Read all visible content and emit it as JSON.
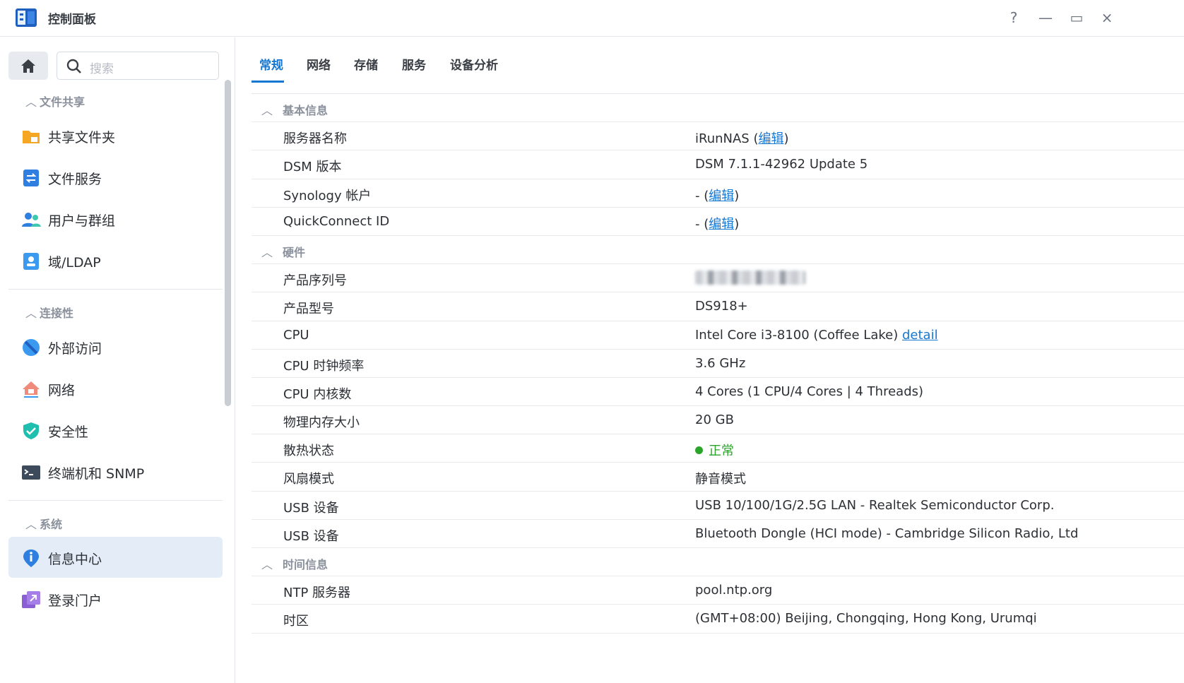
{
  "app": {
    "title": "控制面板",
    "icon": "control-panel-icon"
  },
  "window_controls": {
    "help": "?",
    "minimize": "—",
    "maximize": "▭",
    "close": "×"
  },
  "sidebar": {
    "search_placeholder": "搜索",
    "groups": [
      {
        "title": "文件共享",
        "items": [
          {
            "label": "共享文件夹",
            "icon": "shared-folder-icon"
          },
          {
            "label": "文件服务",
            "icon": "file-services-icon"
          },
          {
            "label": "用户与群组",
            "icon": "user-group-icon"
          },
          {
            "label": "域/LDAP",
            "icon": "domain-ldap-icon"
          }
        ]
      },
      {
        "title": "连接性",
        "items": [
          {
            "label": "外部访问",
            "icon": "external-access-icon"
          },
          {
            "label": "网络",
            "icon": "network-icon"
          },
          {
            "label": "安全性",
            "icon": "security-shield-icon"
          },
          {
            "label": "终端机和 SNMP",
            "icon": "terminal-icon"
          }
        ]
      },
      {
        "title": "系统",
        "items": [
          {
            "label": "信息中心",
            "icon": "info-center-icon",
            "active": true
          },
          {
            "label": "登录门户",
            "icon": "login-portal-icon"
          }
        ]
      }
    ]
  },
  "tabs": [
    "常规",
    "网络",
    "存储",
    "服务",
    "设备分析"
  ],
  "active_tab": "常规",
  "sections": {
    "basic": {
      "title": "基本信息",
      "server_name_label": "服务器名称",
      "server_name_value": "iRunNAS",
      "edit": "编辑",
      "dsm_label": "DSM 版本",
      "dsm_value": "DSM 7.1.1-42962 Update 5",
      "synology_label": "Synology 帐户",
      "synology_value": "-",
      "qc_label": "QuickConnect ID",
      "qc_value": "-"
    },
    "hardware": {
      "title": "硬件",
      "serial_label": "产品序列号",
      "model_label": "产品型号",
      "model_value": "DS918+",
      "cpu_label": "CPU",
      "cpu_value": "Intel Core i3-8100 (Coffee Lake)",
      "cpu_link": "detail",
      "clock_label": "CPU 时钟频率",
      "clock_value": "3.6 GHz",
      "cores_label": "CPU 内核数",
      "cores_value": "4 Cores (1 CPU/4 Cores | 4 Threads)",
      "mem_label": "物理内存大小",
      "mem_value": "20 GB",
      "thermal_label": "散热状态",
      "thermal_value": "正常",
      "fan_label": "风扇模式",
      "fan_value": "静音模式",
      "usb1_label": "USB 设备",
      "usb1_value": "USB 10/100/1G/2.5G LAN - Realtek Semiconductor Corp.",
      "usb2_label": "USB 设备",
      "usb2_value": "Bluetooth Dongle (HCI mode) - Cambridge Silicon Radio, Ltd"
    },
    "time": {
      "title": "时间信息",
      "ntp_label": "NTP 服务器",
      "ntp_value": "pool.ntp.org",
      "tz_label": "时区",
      "tz_value": "(GMT+08:00) Beijing, Chongqing, Hong Kong, Urumqi"
    }
  },
  "colors": {
    "accent": "#1677d2",
    "ok": "#2aa52a",
    "active_bg": "#e3ecf7"
  }
}
